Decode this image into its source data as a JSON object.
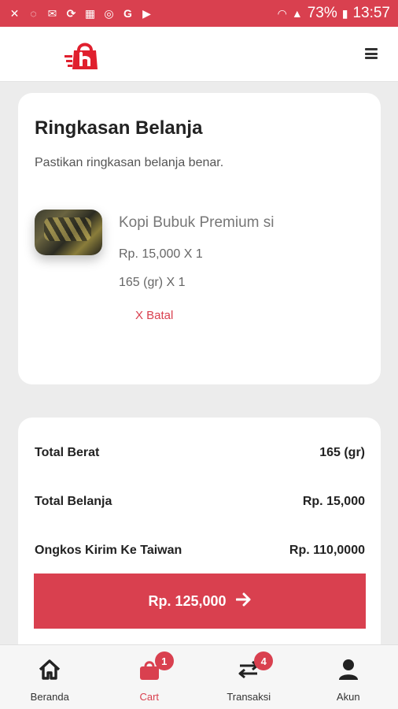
{
  "status_bar": {
    "battery": "73%",
    "time": "13:57",
    "notif_icons": [
      "missed-call-icon",
      "whatsapp-icon",
      "mail-icon",
      "sync-icon",
      "calendar-icon",
      "instagram-icon",
      "google-icon",
      "play-icon"
    ]
  },
  "header": {
    "brand_color": "#d9404f"
  },
  "summary": {
    "title": "Ringkasan Belanja",
    "subtitle": "Pastikan ringkasan belanja benar.",
    "item": {
      "name": "Kopi Bubuk Premium si",
      "price_line": "Rp. 15,000 X 1",
      "weight_line": "165 (gr) X 1",
      "cancel_label": "X Batal"
    }
  },
  "totals": {
    "weight_label": "Total Berat",
    "weight_value": "165 (gr)",
    "spend_label": "Total Belanja",
    "spend_value": "Rp. 15,000",
    "shipping_label": "Ongkos Kirim Ke Taiwan",
    "shipping_value": "Rp. 110,0000",
    "pay_button": "Rp. 125,000"
  },
  "bottom_nav": {
    "home": "Beranda",
    "cart": "Cart",
    "cart_badge": "1",
    "transactions": "Transaksi",
    "transactions_badge": "4",
    "account": "Akun",
    "active": "Cart"
  }
}
